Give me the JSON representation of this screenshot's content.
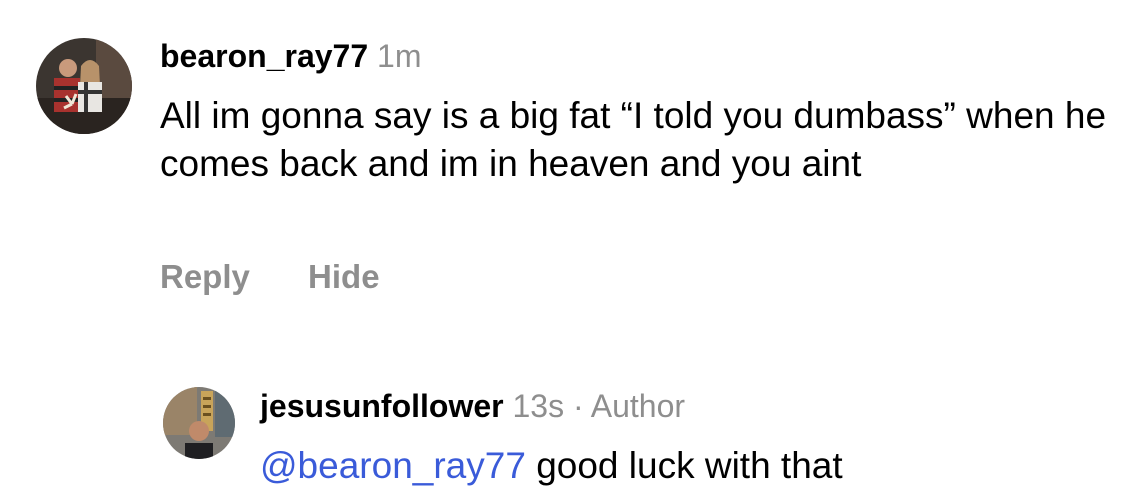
{
  "comment": {
    "username": "bearon_ray77",
    "time": "1m",
    "text": "All im gonna say is a big fat “I told you dumbass” when he comes back and im in heaven and you aint",
    "actions": {
      "reply": "Reply",
      "hide": "Hide"
    }
  },
  "reply": {
    "username": "jesusunfollower",
    "time": "13s",
    "separator": "·",
    "badge": "Author",
    "mention": "@bearon_ray77",
    "text": "good luck with that"
  },
  "colors": {
    "meta": "#8e8e8e",
    "mention": "#3a5bd9",
    "text": "#000000",
    "background": "#ffffff"
  }
}
